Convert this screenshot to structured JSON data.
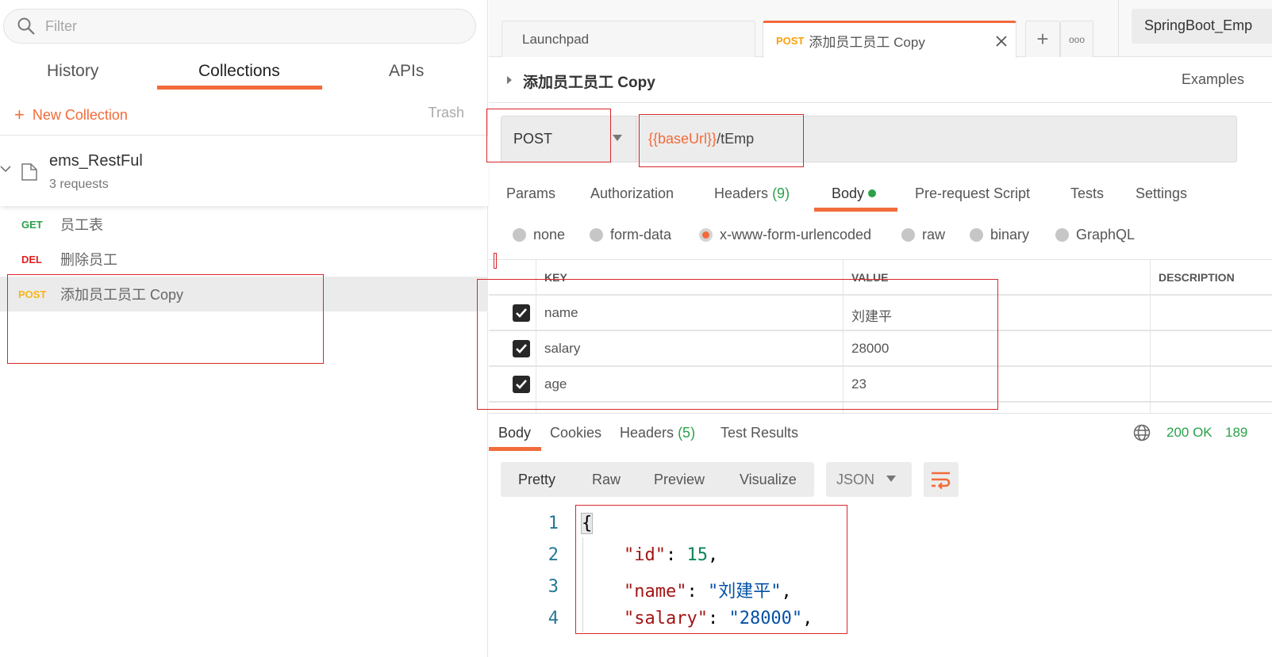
{
  "sidebar": {
    "filter_placeholder": "Filter",
    "tabs": [
      {
        "label": "History",
        "active": false
      },
      {
        "label": "Collections",
        "active": true
      },
      {
        "label": "APIs",
        "active": false
      }
    ],
    "new_collection_label": "New Collection",
    "trash_label": "Trash",
    "collection": {
      "name": "ems_RestFul",
      "count": "3 requests"
    },
    "requests": [
      {
        "method": "GET",
        "name": "员工表",
        "active": false
      },
      {
        "method": "DEL",
        "name": "删除员工",
        "active": false
      },
      {
        "method": "POST",
        "name": "添加员工员工 Copy",
        "active": true
      }
    ]
  },
  "tabs": {
    "launchpad": "Launchpad",
    "active_method": "POST",
    "active_name": "添加员工员工 Copy",
    "close_glyph": "✕",
    "plus_glyph": "+",
    "more_glyph": "ooo"
  },
  "environment": "SpringBoot_Emp",
  "request": {
    "title": "添加员工员工 Copy",
    "examples_label": "Examples",
    "method": "POST",
    "url_variable": "{{baseUrl}}",
    "url_path": "/tEmp",
    "tabs": [
      {
        "label": "Params"
      },
      {
        "label": "Authorization"
      },
      {
        "label": "Headers",
        "count": "(9)"
      },
      {
        "label": "Body",
        "active": true
      },
      {
        "label": "Pre-request Script"
      },
      {
        "label": "Tests"
      },
      {
        "label": "Settings"
      }
    ],
    "body_types": [
      {
        "label": "none",
        "selected": false
      },
      {
        "label": "form-data",
        "selected": false
      },
      {
        "label": "x-www-form-urlencoded",
        "selected": true
      },
      {
        "label": "raw",
        "selected": false
      },
      {
        "label": "binary",
        "selected": false
      },
      {
        "label": "GraphQL",
        "selected": false
      }
    ],
    "table": {
      "headers": [
        "KEY",
        "VALUE",
        "DESCRIPTION"
      ],
      "rows": [
        {
          "checked": true,
          "key": "name",
          "value": "刘建平",
          "description": ""
        },
        {
          "checked": true,
          "key": "salary",
          "value": "28000",
          "description": ""
        },
        {
          "checked": true,
          "key": "age",
          "value": "23",
          "description": ""
        }
      ]
    }
  },
  "response": {
    "tabs": [
      {
        "label": "Body",
        "active": true
      },
      {
        "label": "Cookies"
      },
      {
        "label": "Headers",
        "count": "(5)"
      },
      {
        "label": "Test Results"
      }
    ],
    "status": "200 OK",
    "time": "189",
    "formats": [
      "Pretty",
      "Raw",
      "Preview",
      "Visualize"
    ],
    "active_format": "Pretty",
    "language": "JSON",
    "code_lines": [
      {
        "num": "1",
        "open": "{"
      },
      {
        "num": "2",
        "key": "\"id\"",
        "sep": ": ",
        "num_val": "15",
        "tail": ","
      },
      {
        "num": "3",
        "key": "\"name\"",
        "sep": ": ",
        "str_val": "\"刘建平\"",
        "tail": ","
      },
      {
        "num": "4",
        "key": "\"salary\"",
        "sep": ": ",
        "str_val": "\"28000\"",
        "tail": ","
      }
    ]
  }
}
